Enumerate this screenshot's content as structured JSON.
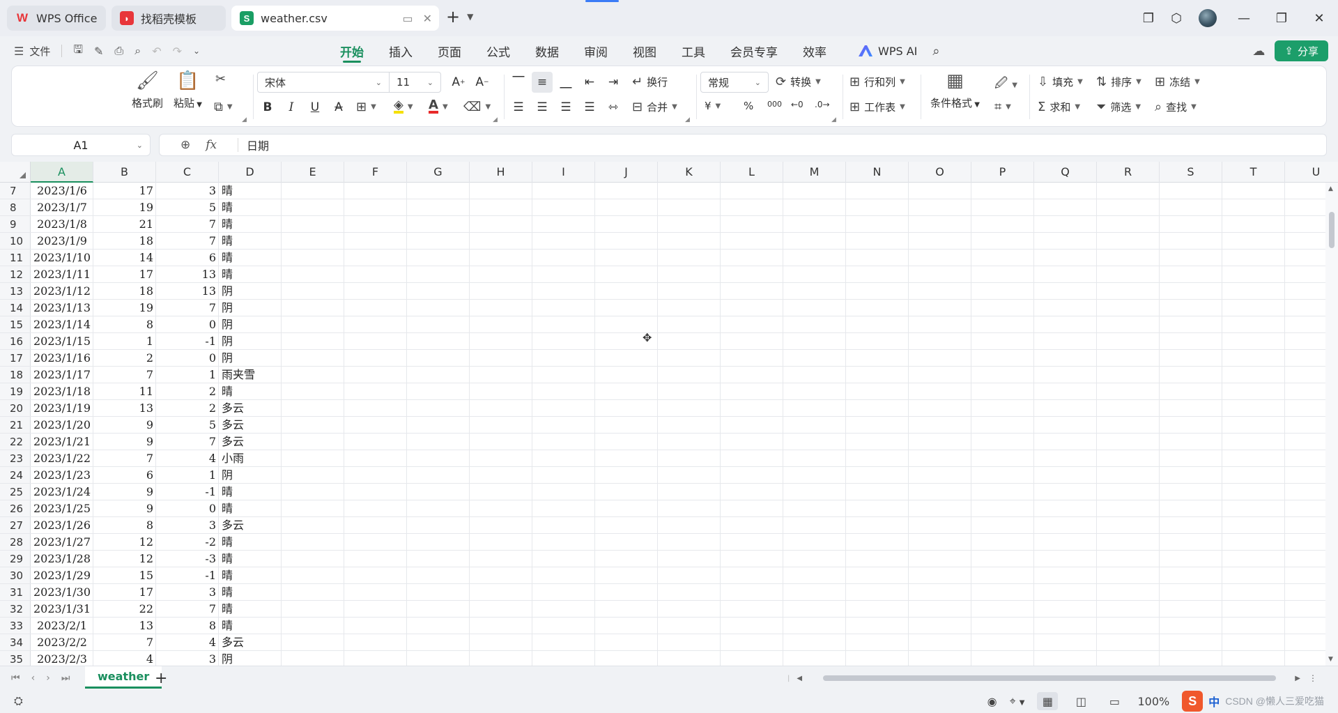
{
  "titlebar": {
    "tabs": [
      {
        "label": "WPS Office",
        "logo": "W",
        "logo_color": "#e8363a"
      },
      {
        "label": "找稻壳模板",
        "logo": "◐",
        "logo_color": "#e8363a"
      },
      {
        "label": "weather.csv",
        "logo": "S",
        "logo_color": "#1a9e64"
      }
    ],
    "new_tab": "+"
  },
  "menu": {
    "file_label": "文件",
    "tabs": [
      "开始",
      "插入",
      "页面",
      "公式",
      "数据",
      "审阅",
      "视图",
      "工具",
      "会员专享",
      "效率"
    ],
    "active_tab": "开始",
    "wps_ai": "WPS AI",
    "share": "分享"
  },
  "ribbon": {
    "format_painter": "格式刷",
    "paste": "粘贴",
    "font_name": "宋体",
    "font_size": "11",
    "wrap": "换行",
    "merge": "合并",
    "number_format": "常规",
    "convert": "转换",
    "currency": "¥",
    "percent": "%",
    "thousands": "000",
    "row_col": "行和列",
    "worksheet": "工作表",
    "cond_format": "条件格式",
    "fill": "填充",
    "sort": "排序",
    "freeze": "冻结",
    "sum": "求和",
    "filter": "筛选",
    "find": "查找"
  },
  "formula": {
    "name_box": "A1",
    "fx_label": "fx",
    "value": "日期"
  },
  "grid": {
    "columns": [
      "A",
      "B",
      "C",
      "D",
      "E",
      "F",
      "G",
      "H",
      "I",
      "J",
      "K",
      "L",
      "M",
      "N",
      "O",
      "P",
      "Q",
      "R",
      "S",
      "T",
      "U"
    ],
    "selected_column": "A",
    "rows": [
      {
        "n": "7",
        "date": "2023/1/6",
        "hi": "17",
        "lo": "3",
        "w": "晴"
      },
      {
        "n": "8",
        "date": "2023/1/7",
        "hi": "19",
        "lo": "5",
        "w": "晴"
      },
      {
        "n": "9",
        "date": "2023/1/8",
        "hi": "21",
        "lo": "7",
        "w": "晴"
      },
      {
        "n": "10",
        "date": "2023/1/9",
        "hi": "18",
        "lo": "7",
        "w": "晴"
      },
      {
        "n": "11",
        "date": "2023/1/10",
        "hi": "14",
        "lo": "6",
        "w": "晴"
      },
      {
        "n": "12",
        "date": "2023/1/11",
        "hi": "17",
        "lo": "13",
        "w": "晴"
      },
      {
        "n": "13",
        "date": "2023/1/12",
        "hi": "18",
        "lo": "13",
        "w": "阴"
      },
      {
        "n": "14",
        "date": "2023/1/13",
        "hi": "19",
        "lo": "7",
        "w": "阴"
      },
      {
        "n": "15",
        "date": "2023/1/14",
        "hi": "8",
        "lo": "0",
        "w": "阴"
      },
      {
        "n": "16",
        "date": "2023/1/15",
        "hi": "1",
        "lo": "-1",
        "w": "阴"
      },
      {
        "n": "17",
        "date": "2023/1/16",
        "hi": "2",
        "lo": "0",
        "w": "阴"
      },
      {
        "n": "18",
        "date": "2023/1/17",
        "hi": "7",
        "lo": "1",
        "w": "雨夹雪"
      },
      {
        "n": "19",
        "date": "2023/1/18",
        "hi": "11",
        "lo": "2",
        "w": "晴"
      },
      {
        "n": "20",
        "date": "2023/1/19",
        "hi": "13",
        "lo": "2",
        "w": "多云"
      },
      {
        "n": "21",
        "date": "2023/1/20",
        "hi": "9",
        "lo": "5",
        "w": "多云"
      },
      {
        "n": "22",
        "date": "2023/1/21",
        "hi": "9",
        "lo": "7",
        "w": "多云"
      },
      {
        "n": "23",
        "date": "2023/1/22",
        "hi": "7",
        "lo": "4",
        "w": "小雨"
      },
      {
        "n": "24",
        "date": "2023/1/23",
        "hi": "6",
        "lo": "1",
        "w": "阴"
      },
      {
        "n": "25",
        "date": "2023/1/24",
        "hi": "9",
        "lo": "-1",
        "w": "晴"
      },
      {
        "n": "26",
        "date": "2023/1/25",
        "hi": "9",
        "lo": "0",
        "w": "晴"
      },
      {
        "n": "27",
        "date": "2023/1/26",
        "hi": "8",
        "lo": "3",
        "w": "多云"
      },
      {
        "n": "28",
        "date": "2023/1/27",
        "hi": "12",
        "lo": "-2",
        "w": "晴"
      },
      {
        "n": "29",
        "date": "2023/1/28",
        "hi": "12",
        "lo": "-3",
        "w": "晴"
      },
      {
        "n": "30",
        "date": "2023/1/29",
        "hi": "15",
        "lo": "-1",
        "w": "晴"
      },
      {
        "n": "31",
        "date": "2023/1/30",
        "hi": "17",
        "lo": "3",
        "w": "晴"
      },
      {
        "n": "32",
        "date": "2023/1/31",
        "hi": "22",
        "lo": "7",
        "w": "晴"
      },
      {
        "n": "33",
        "date": "2023/2/1",
        "hi": "13",
        "lo": "8",
        "w": "晴"
      },
      {
        "n": "34",
        "date": "2023/2/2",
        "hi": "7",
        "lo": "4",
        "w": "多云"
      },
      {
        "n": "35",
        "date": "2023/2/3",
        "hi": "4",
        "lo": "3",
        "w": "阴"
      }
    ]
  },
  "sheets": {
    "active": "weather",
    "add": "+"
  },
  "status": {
    "zoom": "100%",
    "ime_logo": "S",
    "ime_lang": "中",
    "watermark": "CSDN @懒人三爱吃猫"
  },
  "colors": {
    "accent": "#1a8f5e",
    "share": "#1c9e6a"
  }
}
